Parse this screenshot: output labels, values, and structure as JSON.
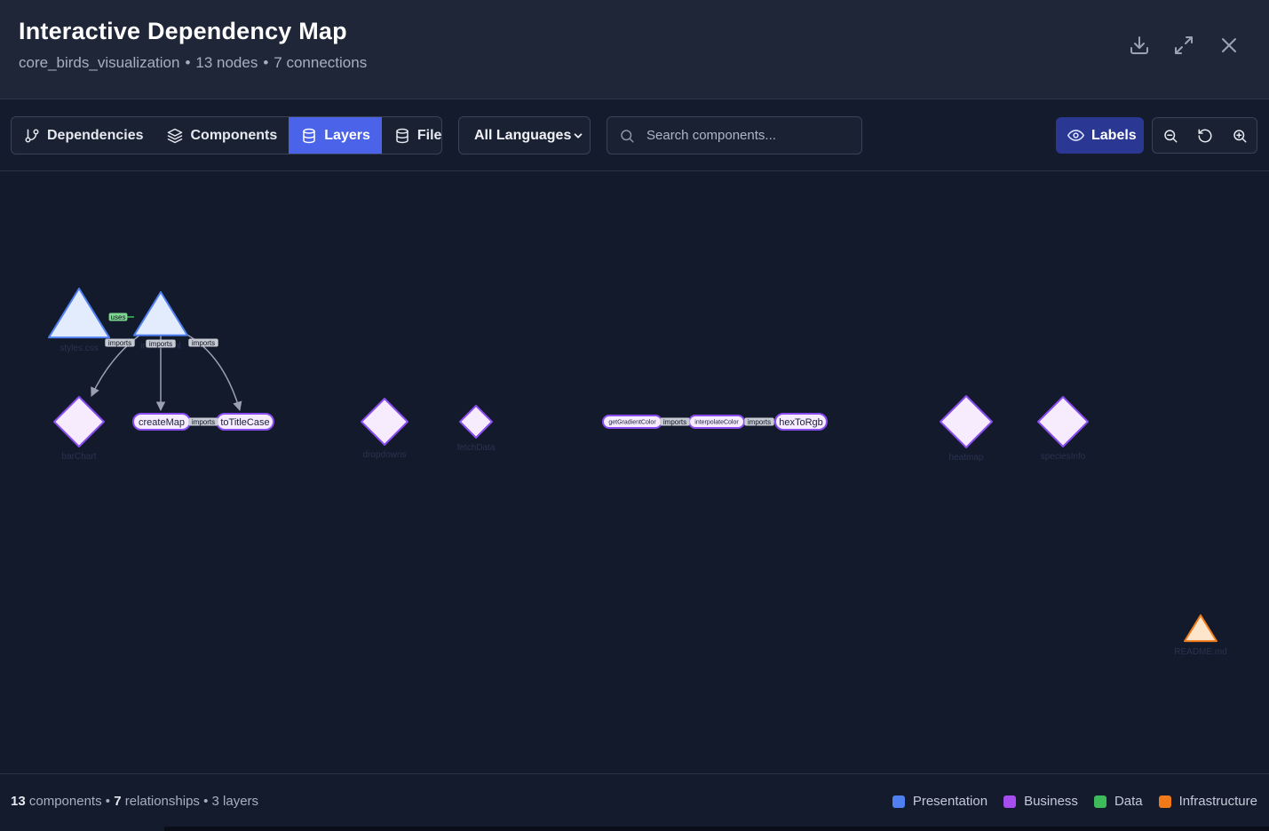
{
  "header": {
    "title": "Interactive Dependency Map",
    "project": "core_birds_visualization",
    "nodes_text": "13 nodes",
    "connections_text": "7 connections",
    "separator": "•"
  },
  "toolbar": {
    "tabs": [
      {
        "label": "Dependencies",
        "icon": "git-branch-icon",
        "active": false
      },
      {
        "label": "Components",
        "icon": "layers-stack-icon",
        "active": false
      },
      {
        "label": "Layers",
        "icon": "database-icon",
        "active": true
      },
      {
        "label": "Files",
        "icon": "database-icon",
        "active": false
      }
    ],
    "language_select": {
      "value": "All Languages"
    },
    "search": {
      "placeholder": "Search components..."
    },
    "labels_button": "Labels"
  },
  "graph": {
    "nodes": [
      {
        "id": "styles",
        "label": "styles.css",
        "shape": "triangle",
        "layer": "Presentation"
      },
      {
        "id": "index",
        "label": "index.html",
        "shape": "triangle",
        "layer": "Presentation"
      },
      {
        "id": "barChart",
        "label": "barChart",
        "shape": "diamond",
        "layer": "Business"
      },
      {
        "id": "createMap",
        "label": "createMap",
        "shape": "pill",
        "layer": "Business"
      },
      {
        "id": "toTitleCase",
        "label": "toTitleCase",
        "shape": "pill",
        "layer": "Business"
      },
      {
        "id": "dropdowns",
        "label": "dropdowns",
        "shape": "diamond",
        "layer": "Business"
      },
      {
        "id": "fetchData",
        "label": "fetchData",
        "shape": "diamond",
        "layer": "Business"
      },
      {
        "id": "getGradientColor",
        "label": "getGradientColor",
        "shape": "pill",
        "layer": "Business"
      },
      {
        "id": "interpolateColor",
        "label": "interpolateColor",
        "shape": "pill",
        "layer": "Business"
      },
      {
        "id": "hexToRgb",
        "label": "hexToRgb",
        "shape": "pill",
        "layer": "Business"
      },
      {
        "id": "heatmap",
        "label": "heatmap",
        "shape": "diamond",
        "layer": "Business"
      },
      {
        "id": "speciesInfo",
        "label": "speciesInfo",
        "shape": "diamond",
        "layer": "Business"
      },
      {
        "id": "readme",
        "label": "README.md",
        "shape": "triangle",
        "layer": "Infrastructure"
      }
    ],
    "edges": [
      {
        "from": "styles",
        "to": "index",
        "label": "uses"
      },
      {
        "from": "index",
        "to": "barChart",
        "label": "imports"
      },
      {
        "from": "index",
        "to": "createMap",
        "label": "imports"
      },
      {
        "from": "index",
        "to": "toTitleCase",
        "label": "imports"
      },
      {
        "from": "createMap",
        "to": "toTitleCase",
        "label": "imports"
      },
      {
        "from": "getGradientColor",
        "to": "interpolateColor",
        "label": "imports"
      },
      {
        "from": "interpolateColor",
        "to": "hexToRgb",
        "label": "imports"
      }
    ]
  },
  "footer": {
    "components_count": "13",
    "components_text": "components",
    "relationships_count": "7",
    "relationships_text": "relationships",
    "layers_text": "3 layers",
    "separator": "•",
    "legend": [
      {
        "label": "Presentation",
        "color": "#4f7ff0"
      },
      {
        "label": "Business",
        "color": "#a64df0"
      },
      {
        "label": "Data",
        "color": "#3dbb5a"
      },
      {
        "label": "Infrastructure",
        "color": "#f07a1a"
      }
    ]
  }
}
